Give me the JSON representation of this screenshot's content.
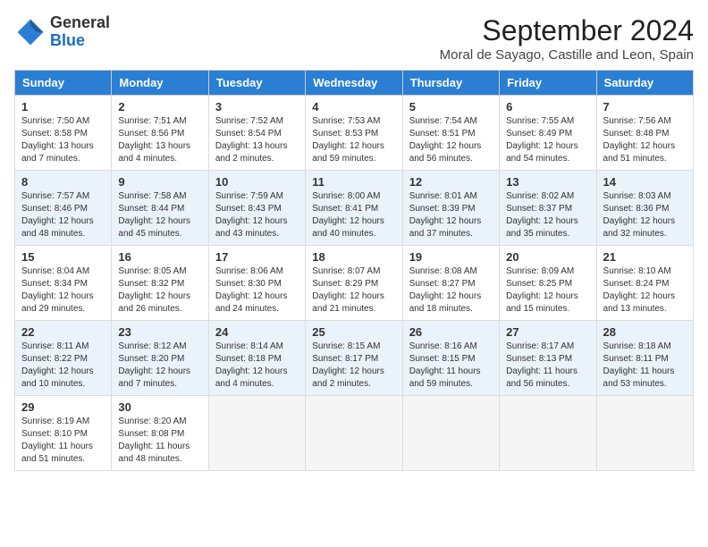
{
  "header": {
    "logo_line1": "General",
    "logo_line2": "Blue",
    "month": "September 2024",
    "location": "Moral de Sayago, Castille and Leon, Spain"
  },
  "weekdays": [
    "Sunday",
    "Monday",
    "Tuesday",
    "Wednesday",
    "Thursday",
    "Friday",
    "Saturday"
  ],
  "weeks": [
    [
      {
        "day": "1",
        "info": "Sunrise: 7:50 AM\nSunset: 8:58 PM\nDaylight: 13 hours\nand 7 minutes."
      },
      {
        "day": "2",
        "info": "Sunrise: 7:51 AM\nSunset: 8:56 PM\nDaylight: 13 hours\nand 4 minutes."
      },
      {
        "day": "3",
        "info": "Sunrise: 7:52 AM\nSunset: 8:54 PM\nDaylight: 13 hours\nand 2 minutes."
      },
      {
        "day": "4",
        "info": "Sunrise: 7:53 AM\nSunset: 8:53 PM\nDaylight: 12 hours\nand 59 minutes."
      },
      {
        "day": "5",
        "info": "Sunrise: 7:54 AM\nSunset: 8:51 PM\nDaylight: 12 hours\nand 56 minutes."
      },
      {
        "day": "6",
        "info": "Sunrise: 7:55 AM\nSunset: 8:49 PM\nDaylight: 12 hours\nand 54 minutes."
      },
      {
        "day": "7",
        "info": "Sunrise: 7:56 AM\nSunset: 8:48 PM\nDaylight: 12 hours\nand 51 minutes."
      }
    ],
    [
      {
        "day": "8",
        "info": "Sunrise: 7:57 AM\nSunset: 8:46 PM\nDaylight: 12 hours\nand 48 minutes."
      },
      {
        "day": "9",
        "info": "Sunrise: 7:58 AM\nSunset: 8:44 PM\nDaylight: 12 hours\nand 45 minutes."
      },
      {
        "day": "10",
        "info": "Sunrise: 7:59 AM\nSunset: 8:43 PM\nDaylight: 12 hours\nand 43 minutes."
      },
      {
        "day": "11",
        "info": "Sunrise: 8:00 AM\nSunset: 8:41 PM\nDaylight: 12 hours\nand 40 minutes."
      },
      {
        "day": "12",
        "info": "Sunrise: 8:01 AM\nSunset: 8:39 PM\nDaylight: 12 hours\nand 37 minutes."
      },
      {
        "day": "13",
        "info": "Sunrise: 8:02 AM\nSunset: 8:37 PM\nDaylight: 12 hours\nand 35 minutes."
      },
      {
        "day": "14",
        "info": "Sunrise: 8:03 AM\nSunset: 8:36 PM\nDaylight: 12 hours\nand 32 minutes."
      }
    ],
    [
      {
        "day": "15",
        "info": "Sunrise: 8:04 AM\nSunset: 8:34 PM\nDaylight: 12 hours\nand 29 minutes."
      },
      {
        "day": "16",
        "info": "Sunrise: 8:05 AM\nSunset: 8:32 PM\nDaylight: 12 hours\nand 26 minutes."
      },
      {
        "day": "17",
        "info": "Sunrise: 8:06 AM\nSunset: 8:30 PM\nDaylight: 12 hours\nand 24 minutes."
      },
      {
        "day": "18",
        "info": "Sunrise: 8:07 AM\nSunset: 8:29 PM\nDaylight: 12 hours\nand 21 minutes."
      },
      {
        "day": "19",
        "info": "Sunrise: 8:08 AM\nSunset: 8:27 PM\nDaylight: 12 hours\nand 18 minutes."
      },
      {
        "day": "20",
        "info": "Sunrise: 8:09 AM\nSunset: 8:25 PM\nDaylight: 12 hours\nand 15 minutes."
      },
      {
        "day": "21",
        "info": "Sunrise: 8:10 AM\nSunset: 8:24 PM\nDaylight: 12 hours\nand 13 minutes."
      }
    ],
    [
      {
        "day": "22",
        "info": "Sunrise: 8:11 AM\nSunset: 8:22 PM\nDaylight: 12 hours\nand 10 minutes."
      },
      {
        "day": "23",
        "info": "Sunrise: 8:12 AM\nSunset: 8:20 PM\nDaylight: 12 hours\nand 7 minutes."
      },
      {
        "day": "24",
        "info": "Sunrise: 8:14 AM\nSunset: 8:18 PM\nDaylight: 12 hours\nand 4 minutes."
      },
      {
        "day": "25",
        "info": "Sunrise: 8:15 AM\nSunset: 8:17 PM\nDaylight: 12 hours\nand 2 minutes."
      },
      {
        "day": "26",
        "info": "Sunrise: 8:16 AM\nSunset: 8:15 PM\nDaylight: 11 hours\nand 59 minutes."
      },
      {
        "day": "27",
        "info": "Sunrise: 8:17 AM\nSunset: 8:13 PM\nDaylight: 11 hours\nand 56 minutes."
      },
      {
        "day": "28",
        "info": "Sunrise: 8:18 AM\nSunset: 8:11 PM\nDaylight: 11 hours\nand 53 minutes."
      }
    ],
    [
      {
        "day": "29",
        "info": "Sunrise: 8:19 AM\nSunset: 8:10 PM\nDaylight: 11 hours\nand 51 minutes."
      },
      {
        "day": "30",
        "info": "Sunrise: 8:20 AM\nSunset: 8:08 PM\nDaylight: 11 hours\nand 48 minutes."
      },
      {
        "day": "",
        "info": ""
      },
      {
        "day": "",
        "info": ""
      },
      {
        "day": "",
        "info": ""
      },
      {
        "day": "",
        "info": ""
      },
      {
        "day": "",
        "info": ""
      }
    ]
  ]
}
